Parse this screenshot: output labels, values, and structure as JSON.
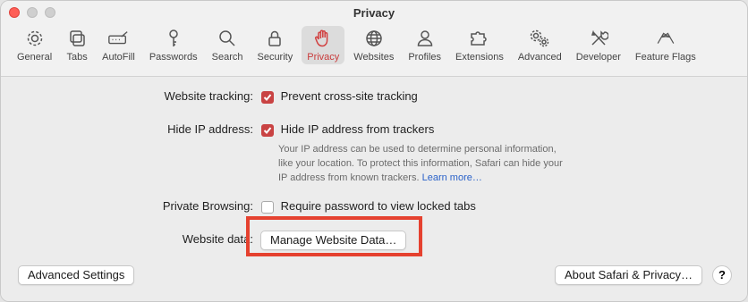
{
  "window": {
    "title": "Privacy"
  },
  "toolbar": {
    "items": [
      {
        "label": "General",
        "icon": "gear-icon"
      },
      {
        "label": "Tabs",
        "icon": "tabs-icon"
      },
      {
        "label": "AutoFill",
        "icon": "autofill-icon"
      },
      {
        "label": "Passwords",
        "icon": "key-icon"
      },
      {
        "label": "Search",
        "icon": "search-icon"
      },
      {
        "label": "Security",
        "icon": "lock-icon"
      },
      {
        "label": "Privacy",
        "icon": "hand-icon",
        "active": true
      },
      {
        "label": "Websites",
        "icon": "globe-icon"
      },
      {
        "label": "Profiles",
        "icon": "person-icon"
      },
      {
        "label": "Extensions",
        "icon": "puzzle-icon"
      },
      {
        "label": "Advanced",
        "icon": "gears-icon"
      },
      {
        "label": "Developer",
        "icon": "tools-icon"
      },
      {
        "label": "Feature Flags",
        "icon": "flags-icon"
      }
    ]
  },
  "settings": {
    "website_tracking": {
      "label": "Website tracking:",
      "option": "Prevent cross-site tracking",
      "checked": true
    },
    "hide_ip": {
      "label": "Hide IP address:",
      "option": "Hide IP address from trackers",
      "checked": true,
      "help_line1": "Your IP address can be used to determine personal information,",
      "help_line2": "like your location. To protect this information, Safari can hide your",
      "help_line3": "IP address from known trackers.",
      "learn_more": "Learn more…"
    },
    "private_browsing": {
      "label": "Private Browsing:",
      "option": "Require password to view locked tabs",
      "checked": false
    },
    "website_data": {
      "label": "Website data:",
      "button": "Manage Website Data…"
    }
  },
  "footer": {
    "advanced_settings": "Advanced Settings",
    "about": "About Safari & Privacy…",
    "help": "?"
  },
  "colors": {
    "accent": "#c94343",
    "highlight_box": "#e5412f"
  }
}
